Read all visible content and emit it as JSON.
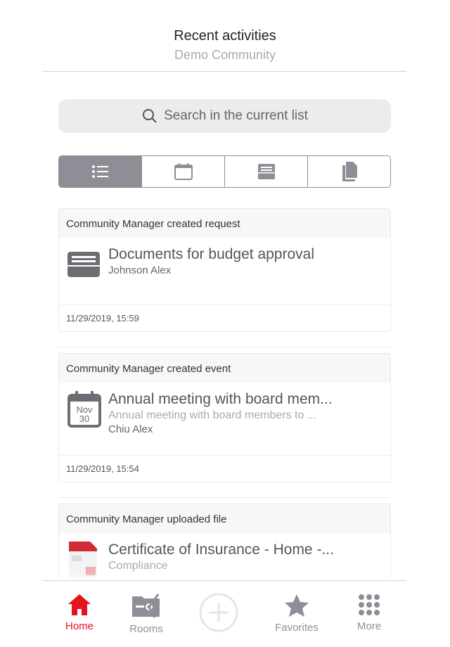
{
  "header": {
    "title": "Recent activities",
    "subtitle": "Demo Community"
  },
  "search": {
    "placeholder": "Search in the current list",
    "icon": "search-icon"
  },
  "filters": [
    {
      "name": "all",
      "icon": "list-icon",
      "selected": true
    },
    {
      "name": "events",
      "icon": "calendar-icon"
    },
    {
      "name": "requests",
      "icon": "inbox-icon"
    },
    {
      "name": "files",
      "icon": "documents-icon"
    }
  ],
  "activities": [
    {
      "header": "Community Manager created request",
      "title": "Documents for budget approval",
      "author": "Johnson Alex",
      "timestamp": "11/29/2019, 15:59",
      "icon": "inbox-icon"
    },
    {
      "header": "Community Manager created event",
      "title": "Annual meeting with board mem...",
      "subtitle": "Annual meeting with board members to ...",
      "author": "Chiu Alex",
      "timestamp": "11/29/2019, 15:54",
      "icon": "calendar-icon",
      "cal_month": "Nov",
      "cal_day": "30"
    },
    {
      "header": "Community Manager uploaded file",
      "title": "Certificate of Insurance - Home -...",
      "subtitle": "Compliance",
      "icon": "pdf-file-icon"
    }
  ],
  "tabbar": {
    "home": "Home",
    "rooms": "Rooms",
    "favorites": "Favorites",
    "more": "More"
  },
  "colors": {
    "accent": "#e3141e",
    "icon_gray": "#8e8f96"
  }
}
